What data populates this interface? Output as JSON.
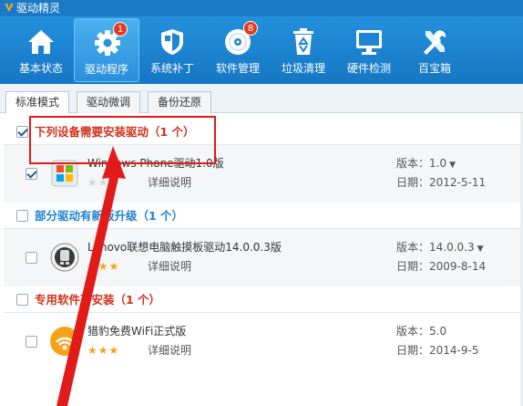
{
  "window": {
    "title": "驱动精灵"
  },
  "toolbar": {
    "items": [
      {
        "label": "基本状态",
        "icon": "home-icon",
        "badge": ""
      },
      {
        "label": "驱动程序",
        "icon": "gear-icon",
        "badge": "1"
      },
      {
        "label": "系统补丁",
        "icon": "shield-icon",
        "badge": ""
      },
      {
        "label": "软件管理",
        "icon": "disc-icon",
        "badge": "8"
      },
      {
        "label": "垃圾清理",
        "icon": "recycle-bin-icon",
        "badge": ""
      },
      {
        "label": "硬件检测",
        "icon": "monitor-icon",
        "badge": ""
      },
      {
        "label": "百宝箱",
        "icon": "tools-icon",
        "badge": ""
      }
    ],
    "active_index": 1
  },
  "tabs": [
    {
      "label": "标准模式"
    },
    {
      "label": "驱动微调"
    },
    {
      "label": "备份还原"
    }
  ],
  "sections": [
    {
      "title": "下列设备需要安装驱动（1 个）",
      "color": "#d0321c",
      "checked": true,
      "items": [
        {
          "name": "Windows Phone驱动1.0版",
          "stars": 0,
          "detail": "详细说明",
          "version": "版本：1.0",
          "date": "日期：2012-5-11",
          "checked": true,
          "icon": "windows-phone-icon"
        }
      ]
    },
    {
      "title": "部分驱动有新版升级（1 个）",
      "color": "#1e82d0",
      "checked": false,
      "items": [
        {
          "name": "Lenovo联想电脑触摸板驱动14.0.0.3版",
          "stars": 3,
          "detail": "详细说明",
          "version": "版本：14.0.0.3",
          "date": "日期：2009-8-14",
          "checked": false,
          "icon": "touchpad-icon"
        }
      ]
    },
    {
      "title": "专用软件可安装（1 个）",
      "color": "#d0321c",
      "checked": false,
      "items": [
        {
          "name": "猎豹免费WiFi正式版",
          "stars": 3,
          "detail": "详细说明",
          "version": "版本：5.0",
          "date": "日期：2014-9-5",
          "checked": false,
          "icon": "wifi-icon"
        }
      ]
    }
  ],
  "colors": {
    "toolbar_bg": "#1a7ac6",
    "annotation": "#e11a1a",
    "star": "#f2a51a"
  }
}
